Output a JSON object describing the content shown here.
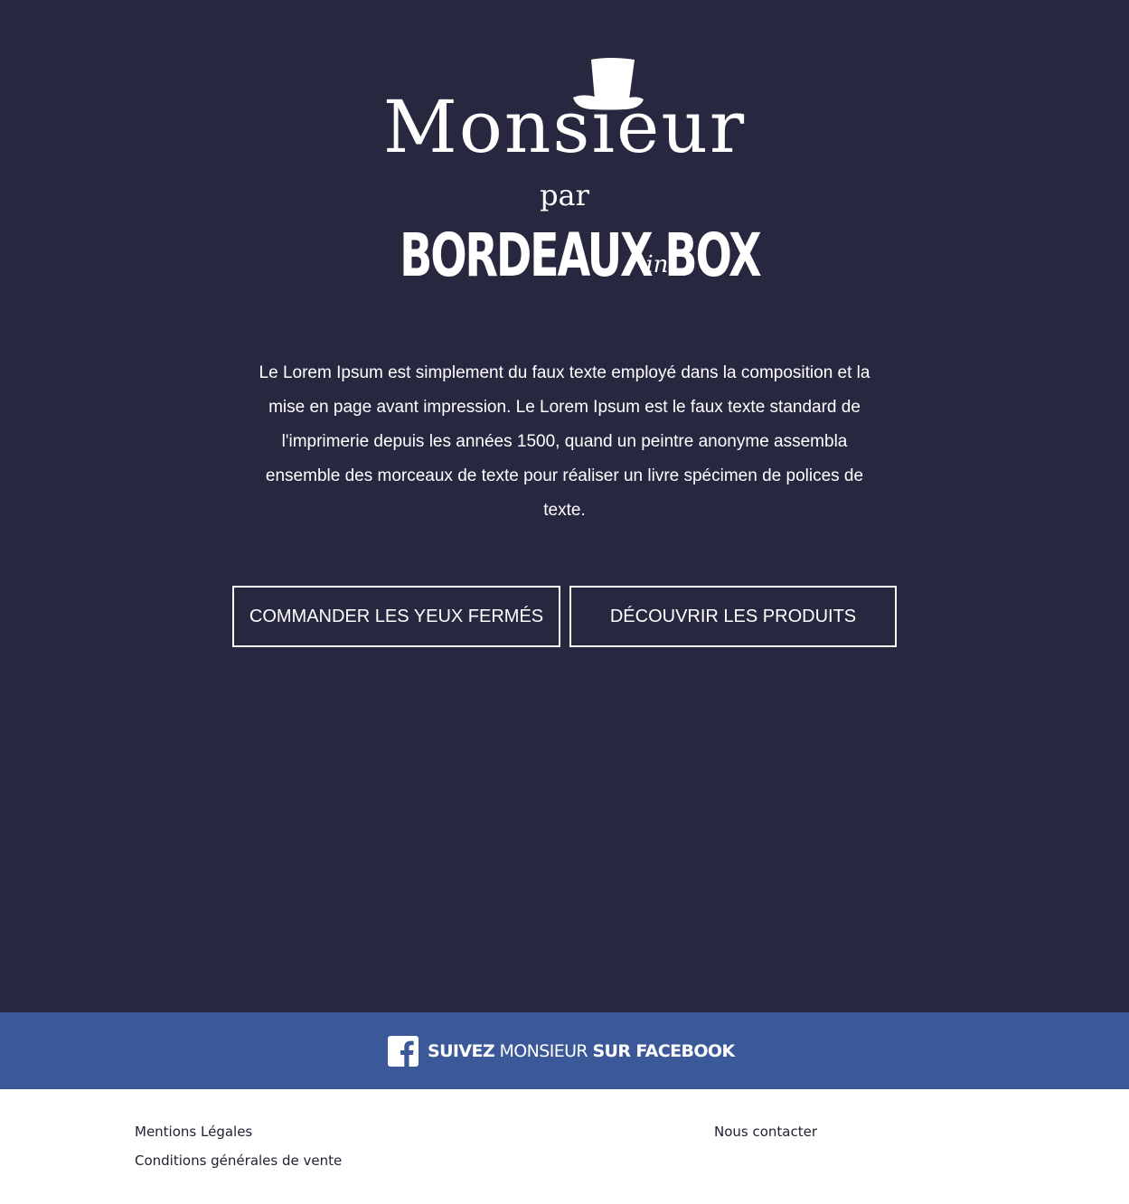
{
  "logo": {
    "title": "Monsieur",
    "par": "par",
    "brand_word1": "BORDEAUX",
    "brand_in": "in",
    "brand_word2": "BOX"
  },
  "intro": {
    "text": "Le Lorem Ipsum est simplement du faux texte employé dans la composition et la mise en page avant impression. Le Lorem Ipsum est le faux texte standard de l'imprimerie depuis les années 1500, quand un peintre anonyme assembla ensemble des morceaux de texte pour réaliser un livre spécimen de polices de texte."
  },
  "buttons": {
    "order_label": "COMMANDER LES YEUX FERMÉS",
    "discover_label": "DÉCOUVRIR LES PRODUITS"
  },
  "facebook": {
    "part1": "SUIVEZ",
    "part2": " MONSIEUR ",
    "part3": "SUR FACEBOOK",
    "icon": "facebook-icon"
  },
  "footer": {
    "mentions": "Mentions Légales",
    "cgv": "Conditions générales de vente",
    "contact": "Nous contacter"
  },
  "colors": {
    "hero_background": "#272840",
    "facebook_blue": "#3b5998",
    "text_white": "#ffffff",
    "footer_text": "#222233"
  }
}
